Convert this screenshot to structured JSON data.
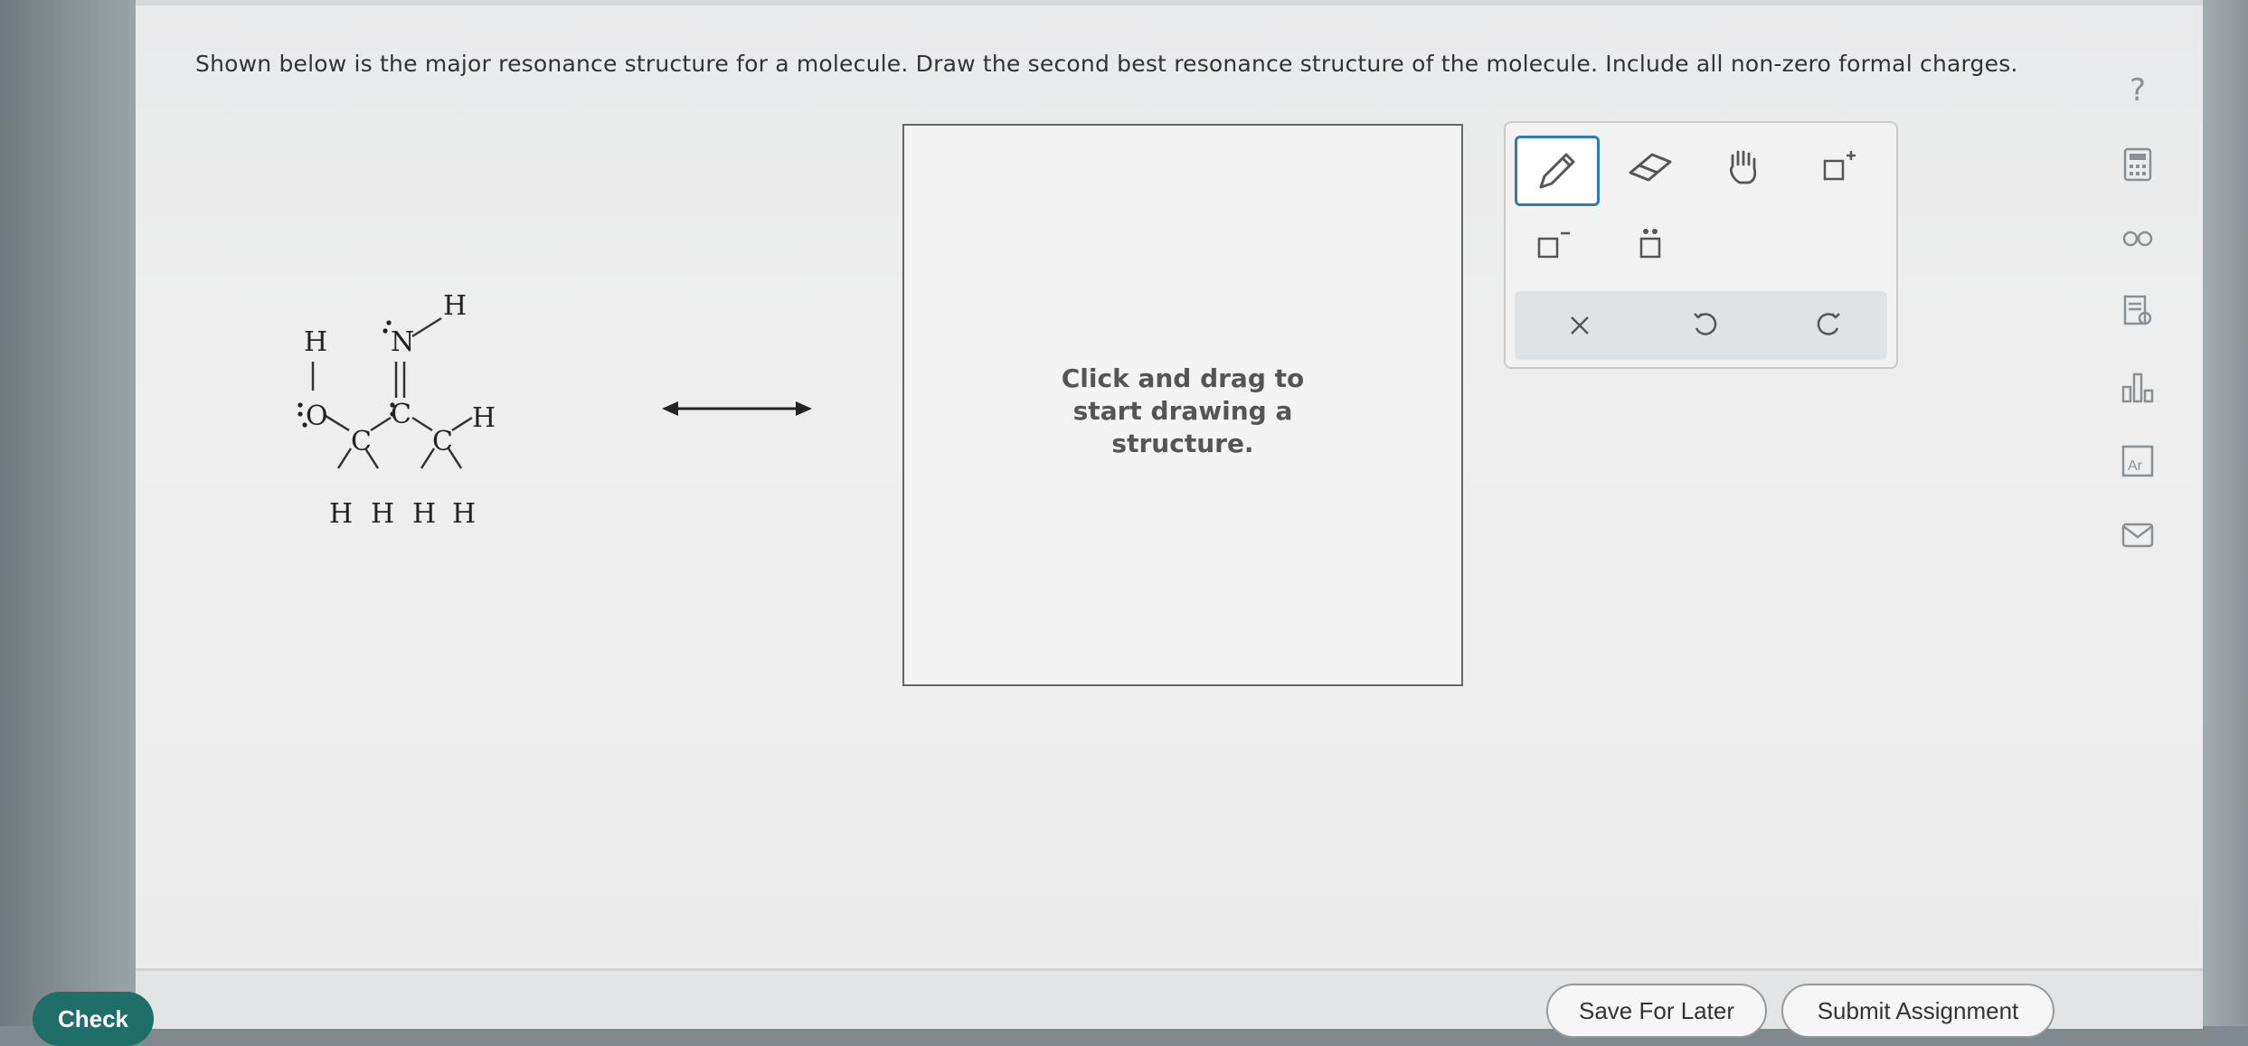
{
  "question": {
    "text": "Shown below is the major resonance structure for a molecule. Draw the second best resonance structure of the molecule. Include all non-zero formal charges."
  },
  "molecule": {
    "atoms": [
      "H",
      "N",
      "H",
      "H",
      "O",
      "C",
      "C",
      "H",
      "C",
      "H",
      "H",
      "H",
      "H"
    ]
  },
  "canvas": {
    "hint_line1": "Click and drag to",
    "hint_line2": "start drawing a",
    "hint_line3": "structure."
  },
  "toolbar": {
    "tools": [
      "pencil-icon",
      "eraser-icon",
      "hand-icon",
      "positive-charge-icon",
      "negative-charge-icon",
      "lone-pair-icon"
    ],
    "actions": [
      "clear-icon",
      "undo-icon",
      "redo-icon"
    ],
    "accent": "#2c7bb6"
  },
  "sidebar": {
    "help": "?",
    "icons": [
      "calculator-icon",
      "infinity-icon",
      "notes-icon",
      "chart-icon",
      "periodic-table-icon",
      "mail-icon"
    ]
  },
  "footer": {
    "check_label": "Check",
    "save_label": "Save For Later",
    "submit_label": "Submit Assignment",
    "check_color": "#1f6e6a"
  }
}
